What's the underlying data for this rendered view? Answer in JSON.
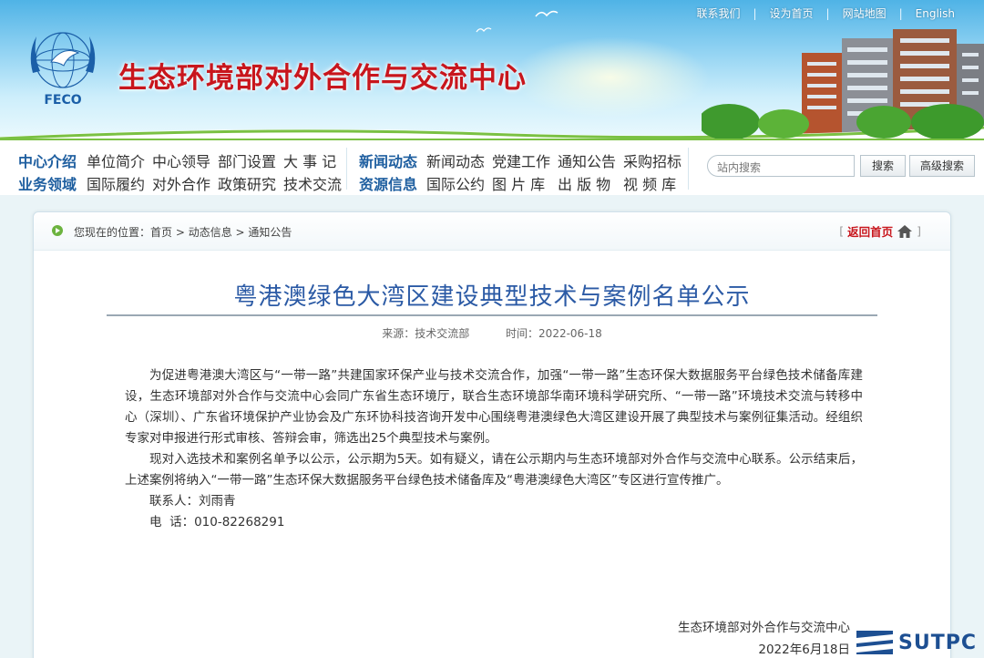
{
  "header": {
    "site_title": "生态环境部对外合作与交流中心",
    "logo_text": "FECO",
    "top_links": [
      "联系我们",
      "设为首页",
      "网站地图",
      "English"
    ]
  },
  "nav": {
    "row1": {
      "category": "中心介绍",
      "items": [
        "单位简介",
        "中心领导",
        "部门设置",
        "大 事 记"
      ],
      "category2": "新闻动态",
      "items2": [
        "新闻动态",
        "党建工作",
        "通知公告",
        "采购招标"
      ]
    },
    "row2": {
      "category": "业务领域",
      "items": [
        "国际履约",
        "对外合作",
        "政策研究",
        "技术交流"
      ],
      "category2": "资源信息",
      "items2": [
        "国际公约",
        "图 片 库",
        "出 版 物",
        "视 频 库"
      ]
    }
  },
  "search": {
    "placeholder": "站内搜索",
    "search_label": "搜索",
    "advanced_label": "高级搜索"
  },
  "breadcrumb": {
    "prefix": "您现在的位置：",
    "items": [
      "首页",
      "动态信息",
      "通知公告"
    ],
    "separator": " > "
  },
  "back_home": {
    "label": "返回首页",
    "open": "[",
    "close": "]"
  },
  "article": {
    "title": "粤港澳绿色大湾区建设典型技术与案例名单公示",
    "source": "来源：技术交流部",
    "time": "时间：2022-06-18",
    "paragraphs": [
      "为促进粤港澳大湾区与“一带一路”共建国家环保产业与技术交流合作，加强“一带一路”生态环保大数据服务平台绿色技术储备库建设，生态环境部对外合作与交流中心会同广东省生态环境厅，联合生态环境部华南环境科学研究所、“一带一路”环境技术交流与转移中心（深圳）、广东省环境保护产业协会及广东环协科技咨询开发中心围绕粤港澳绿色大湾区建设开展了典型技术与案例征集活动。经组织专家对申报进行形式审核、答辩会审，筛选出25个典型技术与案例。",
      "现对入选技术和案例名单予以公示，公示期为5天。如有疑义，请在公示期内与生态环境部对外合作与交流中心联系。公示结束后，上述案例将纳入“一带一路”生态环保大数据服务平台绿色技术储备库及“粤港澳绿色大湾区”专区进行宣传推广。"
    ],
    "contact_person": "联系人：刘雨青",
    "phone": "电  话：010-82268291",
    "signature_org": "生态环境部对外合作与交流中心",
    "signature_date": "2022年6月18日"
  },
  "watermark": {
    "text": "SUTPC"
  },
  "colors": {
    "title_red": "#c8161d",
    "article_blue": "#2b5aa5",
    "nav_blue": "#1f5fa0",
    "accent_green": "#6cb33f"
  }
}
